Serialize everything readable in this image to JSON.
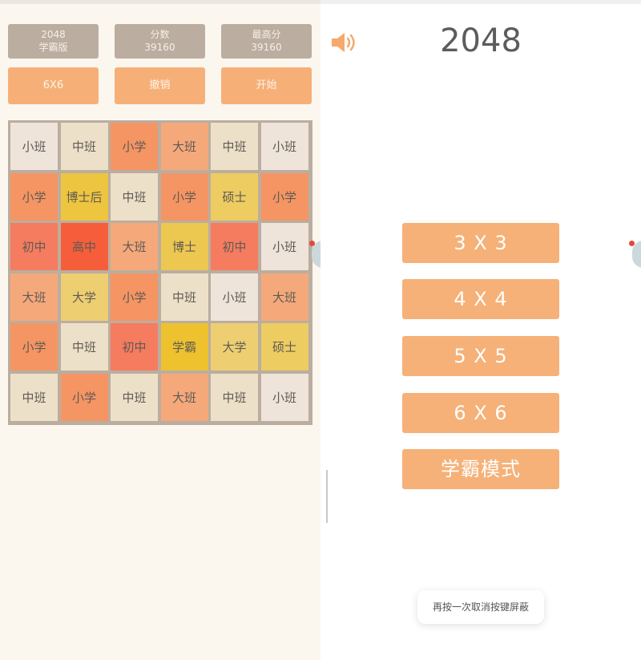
{
  "left": {
    "info": [
      {
        "line1": "2048",
        "line2": "学霸版"
      },
      {
        "line1": "分数",
        "line2": "39160"
      },
      {
        "line1": "最高分",
        "line2": "39160"
      }
    ],
    "controls": [
      "6X6",
      "撤销",
      "开始"
    ],
    "board": [
      [
        "小班",
        "中班",
        "小学",
        "大班",
        "中班",
        "小班"
      ],
      [
        "小学",
        "博士后",
        "中班",
        "小学",
        "硕士",
        "小学"
      ],
      [
        "初中",
        "高中",
        "大班",
        "博士",
        "初中",
        "小班"
      ],
      [
        "大班",
        "大学",
        "小学",
        "中班",
        "小班",
        "大班"
      ],
      [
        "小学",
        "中班",
        "初中",
        "学霸",
        "大学",
        "硕士"
      ],
      [
        "中班",
        "小学",
        "中班",
        "大班",
        "中班",
        "小班"
      ]
    ],
    "tile_colors": {
      "小班": "#eee4da",
      "中班": "#ede0c8",
      "大班": "#f5a97a",
      "小学": "#f59563",
      "初中": "#f67c5f",
      "高中": "#f65e3b",
      "大学": "#edcf72",
      "硕士": "#edcc61",
      "博士": "#edc850",
      "博士后": "#edc53f",
      "学霸": "#edc22e"
    }
  },
  "right": {
    "title": "2048",
    "menu": [
      "3 X 3",
      "4 X 4",
      "5 X 5",
      "6 X 6",
      "学霸模式"
    ],
    "toast": "再按一次取消按键屏蔽"
  },
  "colors": {
    "accent": "#f5b178",
    "board_bg": "#bbada0",
    "panel_bg": "#fbf7ef"
  }
}
